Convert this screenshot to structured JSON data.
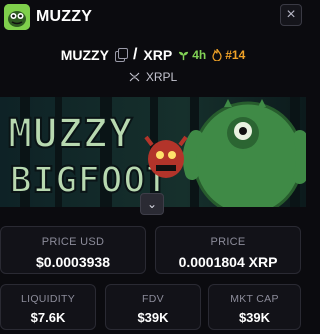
{
  "header": {
    "title": "MUZZY",
    "logo_icon": "bigfoot-logo-icon",
    "close_icon": "close-icon"
  },
  "pair": {
    "base": "MUZZY",
    "separator": "/",
    "quote": "XRP",
    "age": "4h",
    "rank": "#14"
  },
  "chain": {
    "icon": "xrpl-icon",
    "name": "XRPL"
  },
  "banner": {
    "line1": "MUZZY",
    "line2": "BIGFOOT"
  },
  "stats": {
    "price_usd": {
      "label": "PRICE USD",
      "value": "$0.0003938"
    },
    "price": {
      "label": "PRICE",
      "value": "0.0001804 XRP"
    },
    "liquidity": {
      "label": "LIQUIDITY",
      "value": "$7.6K"
    },
    "fdv": {
      "label": "FDV",
      "value": "$39K"
    },
    "mkt_cap": {
      "label": "MKT CAP",
      "value": "$39K"
    }
  },
  "colors": {
    "background": "#0b0b0f",
    "card": "#121218",
    "age_green": "#82d356",
    "rank_orange": "#f0a227",
    "logo_green": "#7fcf4c"
  }
}
